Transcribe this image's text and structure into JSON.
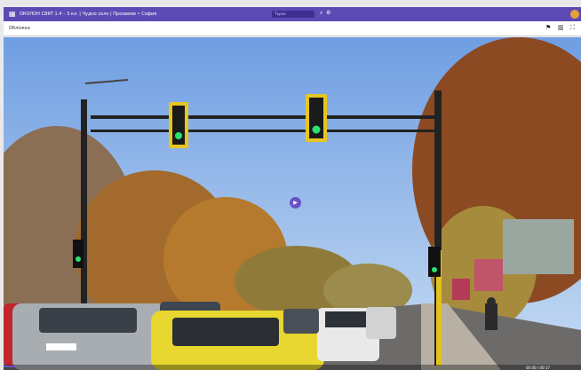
{
  "browser": {
    "title": "ОКОЛОН СВЯТ 1.4 – 3 кл. | Чудно село | Прохвемо • София",
    "search_placeholder": "Търси"
  },
  "toolbar": {
    "section_label": "Обложка"
  },
  "video": {
    "progress": 0.02,
    "time_label": "00:00 / 00:17"
  },
  "icons": {
    "grid": "grid-icon",
    "search": "search-icon",
    "settings": "gear-icon",
    "bookmark": "bookmark-icon",
    "layout": "layout-icon",
    "fullscreen": "fullscreen-icon",
    "play": "play-icon"
  },
  "colors": {
    "accent": "#5c4bb4"
  }
}
